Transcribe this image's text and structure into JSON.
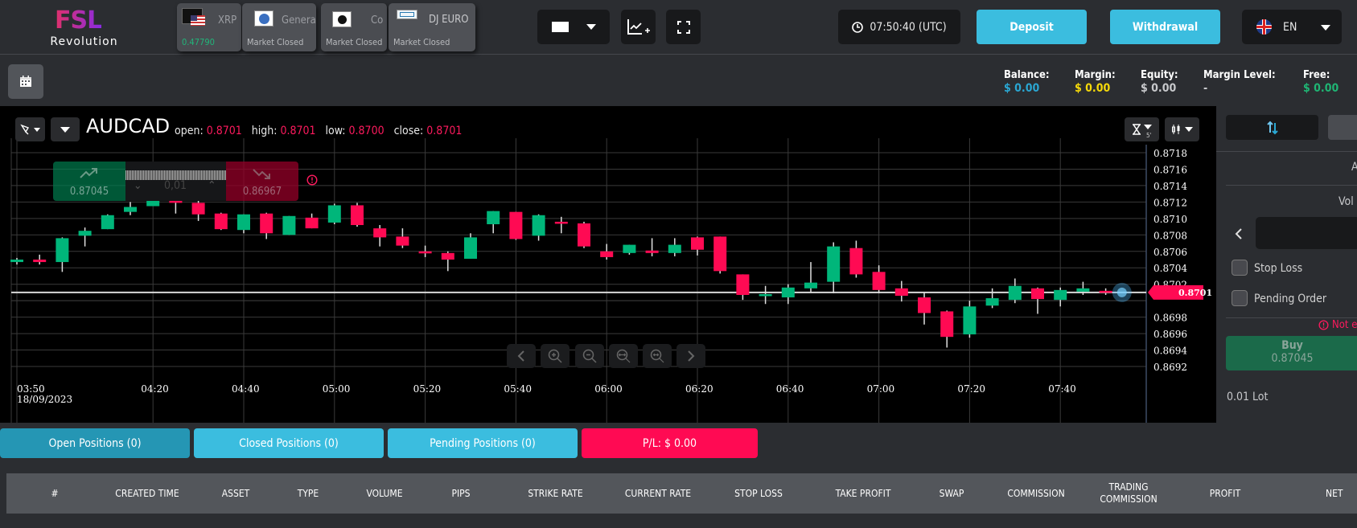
{
  "brand": {
    "mark": "FSL",
    "word": "Revolution"
  },
  "assets": [
    {
      "name": "XRP",
      "status": "0.47790",
      "status_color": "#21b57a",
      "icon": "xrp-usd-flag-icon"
    },
    {
      "name": "General",
      "status": "Market Closed",
      "status_color": "#b8babd",
      "icon": "general-electric-logo-icon"
    },
    {
      "name": "Co",
      "status": "Market Closed",
      "status_color": "#b8babd",
      "icon": "coffee-beans-icon"
    },
    {
      "name": "DJ EURO",
      "status": "Market Closed",
      "status_color": "#b8babd",
      "icon": "dj-euro-logo-icon"
    }
  ],
  "toolbar": {
    "time": "07:50:40 (UTC)",
    "deposit": "Deposit",
    "withdrawal": "Withdrawal",
    "lang": "EN"
  },
  "account": [
    {
      "label": "Balance:",
      "value": "$ 0.00",
      "color": "#2aa7d3"
    },
    {
      "label": "Margin:",
      "value": "$ 0.00",
      "color": "#f5d90a"
    },
    {
      "label": "Equity:",
      "value": "$ 0.00",
      "color": "#c8c9cc"
    },
    {
      "label": "Margin Level:",
      "value": "-",
      "color": "#c8c9cc"
    },
    {
      "label": "Free:",
      "value": "$ 0.00",
      "color": "#1fb574"
    }
  ],
  "chart_header": {
    "symbol": "AUDCAD",
    "open_label": "open:",
    "open": "0.8701",
    "high_label": "high:",
    "high": "0.8701",
    "low_label": "low:",
    "low": "0.8700",
    "close_label": "close:",
    "close": "0.8701",
    "timeframe": "5'"
  },
  "quick_trade": {
    "buy_price": "0.87045",
    "sell_price": "0.86967",
    "lot": "0,01"
  },
  "chart_data": {
    "type": "candlestick",
    "title": "AUDCAD",
    "xlabel": "",
    "ylabel": "",
    "ylim": [
      0.86905,
      0.87195
    ],
    "y_ticks": [
      "0.8718",
      "0.8716",
      "0.8714",
      "0.8712",
      "0.8710",
      "0.8708",
      "0.8706",
      "0.8704",
      "0.8702",
      "0.8698",
      "0.8696",
      "0.8694",
      "0.8692"
    ],
    "x_ticks": [
      "03:50",
      "04:20",
      "04:40",
      "05:00",
      "05:20",
      "05:40",
      "06:00",
      "06:20",
      "06:40",
      "07:00",
      "07:20",
      "07:40"
    ],
    "x_date": "18/09/2023",
    "current_price": "0.8701",
    "candles": [
      {
        "t": "03:50",
        "o": 0.87047,
        "c": 0.8705,
        "h": 0.87052,
        "l": 0.87044
      },
      {
        "t": "03:55",
        "o": 0.8705,
        "c": 0.87047,
        "h": 0.87056,
        "l": 0.87044
      },
      {
        "t": "04:00",
        "o": 0.87047,
        "c": 0.87076,
        "h": 0.87077,
        "l": 0.87035
      },
      {
        "t": "04:05",
        "o": 0.87079,
        "c": 0.87085,
        "h": 0.87089,
        "l": 0.87066
      },
      {
        "t": "04:10",
        "o": 0.87087,
        "c": 0.87104,
        "h": 0.87105,
        "l": 0.87087
      },
      {
        "t": "04:15",
        "o": 0.87108,
        "c": 0.87114,
        "h": 0.8712,
        "l": 0.87104
      },
      {
        "t": "04:20",
        "o": 0.87115,
        "c": 0.87124,
        "h": 0.8715,
        "l": 0.87115
      },
      {
        "t": "04:25",
        "o": 0.87124,
        "c": 0.87119,
        "h": 0.8713,
        "l": 0.87106
      },
      {
        "t": "04:30",
        "o": 0.87119,
        "c": 0.87105,
        "h": 0.87124,
        "l": 0.87097
      },
      {
        "t": "04:35",
        "o": 0.87106,
        "c": 0.87087,
        "h": 0.87107,
        "l": 0.87086
      },
      {
        "t": "04:40",
        "o": 0.87086,
        "c": 0.87105,
        "h": 0.87105,
        "l": 0.87082
      },
      {
        "t": "04:45",
        "o": 0.87106,
        "c": 0.87082,
        "h": 0.87107,
        "l": 0.87075
      },
      {
        "t": "04:50",
        "o": 0.8708,
        "c": 0.87103,
        "h": 0.87103,
        "l": 0.8708
      },
      {
        "t": "04:55",
        "o": 0.87101,
        "c": 0.87088,
        "h": 0.87106,
        "l": 0.87088
      },
      {
        "t": "05:00",
        "o": 0.87095,
        "c": 0.87116,
        "h": 0.87118,
        "l": 0.87093
      },
      {
        "t": "05:05",
        "o": 0.87116,
        "c": 0.87092,
        "h": 0.87119,
        "l": 0.8709
      },
      {
        "t": "05:10",
        "o": 0.87088,
        "c": 0.87077,
        "h": 0.87092,
        "l": 0.87066
      },
      {
        "t": "05:15",
        "o": 0.87078,
        "c": 0.87067,
        "h": 0.87088,
        "l": 0.87064
      },
      {
        "t": "05:20",
        "o": 0.8706,
        "c": 0.87058,
        "h": 0.87067,
        "l": 0.87053
      },
      {
        "t": "05:25",
        "o": 0.87058,
        "c": 0.8705,
        "h": 0.8706,
        "l": 0.87036
      },
      {
        "t": "05:30",
        "o": 0.87051,
        "c": 0.87077,
        "h": 0.87082,
        "l": 0.87051
      },
      {
        "t": "05:35",
        "o": 0.87093,
        "c": 0.87109,
        "h": 0.87109,
        "l": 0.87082
      },
      {
        "t": "05:40",
        "o": 0.87108,
        "c": 0.87075,
        "h": 0.87108,
        "l": 0.87074
      },
      {
        "t": "05:45",
        "o": 0.87079,
        "c": 0.87104,
        "h": 0.87105,
        "l": 0.87073
      },
      {
        "t": "05:50",
        "o": 0.87096,
        "c": 0.87095,
        "h": 0.87102,
        "l": 0.87082
      },
      {
        "t": "05:55",
        "o": 0.87094,
        "c": 0.87066,
        "h": 0.87096,
        "l": 0.87064
      },
      {
        "t": "06:00",
        "o": 0.8706,
        "c": 0.87053,
        "h": 0.87069,
        "l": 0.8705
      },
      {
        "t": "06:05",
        "o": 0.87058,
        "c": 0.87068,
        "h": 0.87068,
        "l": 0.87056
      },
      {
        "t": "06:10",
        "o": 0.87061,
        "c": 0.87058,
        "h": 0.87076,
        "l": 0.87054
      },
      {
        "t": "06:15",
        "o": 0.87058,
        "c": 0.87068,
        "h": 0.87076,
        "l": 0.87054
      },
      {
        "t": "06:20",
        "o": 0.87077,
        "c": 0.87062,
        "h": 0.87078,
        "l": 0.87055
      },
      {
        "t": "06:25",
        "o": 0.87078,
        "c": 0.87036,
        "h": 0.87078,
        "l": 0.87033
      },
      {
        "t": "06:30",
        "o": 0.87032,
        "c": 0.87007,
        "h": 0.87032,
        "l": 0.87001
      },
      {
        "t": "06:35",
        "o": 0.87008,
        "c": 0.87008,
        "h": 0.87018,
        "l": 0.86996
      },
      {
        "t": "06:40",
        "o": 0.87004,
        "c": 0.87016,
        "h": 0.8702,
        "l": 0.86996
      },
      {
        "t": "06:45",
        "o": 0.87015,
        "c": 0.87022,
        "h": 0.87047,
        "l": 0.8701
      },
      {
        "t": "06:50",
        "o": 0.87023,
        "c": 0.87066,
        "h": 0.87071,
        "l": 0.87009
      },
      {
        "t": "06:55",
        "o": 0.87064,
        "c": 0.87032,
        "h": 0.87073,
        "l": 0.87028
      },
      {
        "t": "07:00",
        "o": 0.87035,
        "c": 0.87013,
        "h": 0.87043,
        "l": 0.87009
      },
      {
        "t": "07:05",
        "o": 0.87015,
        "c": 0.87006,
        "h": 0.87024,
        "l": 0.86999
      },
      {
        "t": "07:10",
        "o": 0.87004,
        "c": 0.86985,
        "h": 0.8701,
        "l": 0.86971
      },
      {
        "t": "07:15",
        "o": 0.86987,
        "c": 0.86956,
        "h": 0.86988,
        "l": 0.86943
      },
      {
        "t": "07:20",
        "o": 0.86959,
        "c": 0.86993,
        "h": 0.87,
        "l": 0.86955
      },
      {
        "t": "07:25",
        "o": 0.86994,
        "c": 0.87003,
        "h": 0.87015,
        "l": 0.86991
      },
      {
        "t": "07:30",
        "o": 0.87001,
        "c": 0.87018,
        "h": 0.87027,
        "l": 0.86997
      },
      {
        "t": "07:35",
        "o": 0.87015,
        "c": 0.87002,
        "h": 0.87016,
        "l": 0.86984
      },
      {
        "t": "07:40",
        "o": 0.87001,
        "c": 0.87013,
        "h": 0.87016,
        "l": 0.86993
      },
      {
        "t": "07:45",
        "o": 0.87011,
        "c": 0.87015,
        "h": 0.87023,
        "l": 0.87007
      },
      {
        "t": "07:50",
        "o": 0.87012,
        "c": 0.8701,
        "h": 0.87015,
        "l": 0.87007
      }
    ]
  },
  "chart_nav": [
    "scroll-left",
    "zoom-in",
    "zoom-out",
    "zoom-fit-width",
    "zoom-reset",
    "scroll-right"
  ],
  "right_panel": {
    "amount_label": "A",
    "volume_label": "Vol",
    "stop_loss": "Stop Loss",
    "pending_order": "Pending Order",
    "warning": "Not e",
    "buy_label": "Buy",
    "buy_price": "0.87045",
    "lot": "0.01 Lot"
  },
  "bottom_tabs": [
    {
      "label": "Open Positions  (0)",
      "color": "#2596b4"
    },
    {
      "label": "Closed Positions  (0)",
      "color": "#3bbddf"
    },
    {
      "label": "Pending Positions  (0)",
      "color": "#3bbddf"
    },
    {
      "label": "P/L:  $ 0.00",
      "color": "#ff0a53"
    }
  ],
  "table": {
    "columns": [
      "#",
      "CREATED TIME",
      "ASSET",
      "TYPE",
      "VOLUME",
      "PIPS",
      "STRIKE RATE",
      "CURRENT RATE",
      "STOP LOSS",
      "TAKE PROFIT",
      "SWAP",
      "COMMISSION",
      "TRADING COMMISSION",
      "PROFIT",
      "NET"
    ]
  }
}
